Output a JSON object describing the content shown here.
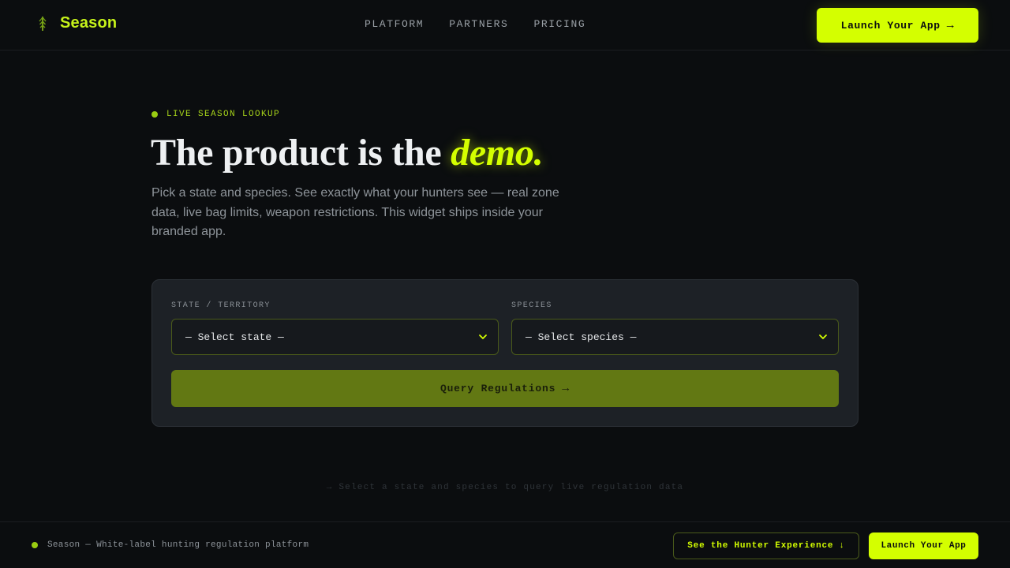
{
  "header": {
    "brand": "Season",
    "brand_icon": "leaf-arrow-icon",
    "nav": [
      {
        "label": "PLATFORM"
      },
      {
        "label": "PARTNERS"
      },
      {
        "label": "PRICING"
      }
    ],
    "launch_label": "Launch Your App",
    "launch_icon": "arrow-right-icon"
  },
  "hero": {
    "eyebrow": "LIVE SEASON LOOKUP",
    "headline_prefix": "The product is the ",
    "headline_emphasis": "demo.",
    "lede": "Pick a state and species. See exactly what your hunters see — real zone data, live bag limits, weapon restrictions. This widget ships inside your branded app."
  },
  "widget": {
    "state_label": "STATE / TERRITORY",
    "state_value": "— Select state —",
    "species_label": "SPECIES",
    "species_value": "— Select species —",
    "query_label": "Query Regulations",
    "query_icon": "arrow-right-icon"
  },
  "hint": "→ Select a state and species to query live regulation data",
  "footer": {
    "tagline": "Season — White-label hunting regulation platform",
    "hunter_label": "See the Hunter Experience",
    "hunter_icon": "arrow-down-icon",
    "launch_label": "Launch Your App"
  },
  "colors": {
    "accent": "#d4ff00",
    "background": "#0b0d0f",
    "card": "#1d2126",
    "query_button": "#627813"
  }
}
